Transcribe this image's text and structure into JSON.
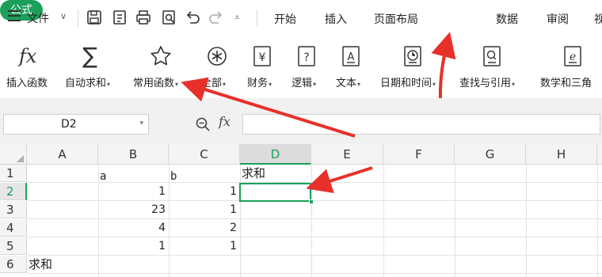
{
  "menubar": {
    "file_label": "文件",
    "tabs": [
      "开始",
      "插入",
      "页面布局",
      "公式",
      "数据",
      "审阅",
      "视"
    ],
    "active_tab": "公式",
    "accent_color": "#1aa05a"
  },
  "ribbon": {
    "buttons": [
      {
        "label": "插入函数",
        "icon": "fx-icon",
        "dropdown": false
      },
      {
        "label": "自动求和",
        "icon": "sum-icon",
        "dropdown": true
      },
      {
        "label": "常用函数",
        "icon": "star-icon",
        "dropdown": true
      },
      {
        "label": "全部",
        "icon": "asterisk-icon",
        "dropdown": true
      },
      {
        "label": "财务",
        "icon": "yen-icon",
        "dropdown": true
      },
      {
        "label": "逻辑",
        "icon": "question-icon",
        "dropdown": true
      },
      {
        "label": "文本",
        "icon": "text-a-icon",
        "dropdown": true
      },
      {
        "label": "日期和时间",
        "icon": "clock-icon",
        "dropdown": true
      },
      {
        "label": "查找与引用",
        "icon": "lookup-icon",
        "dropdown": true
      },
      {
        "label": "数学和三角",
        "icon": "math-e-icon",
        "dropdown": false
      }
    ]
  },
  "formula_bar": {
    "name_box": "D2",
    "fx_label": "fx",
    "formula": ""
  },
  "sheet": {
    "columns": [
      "A",
      "B",
      "C",
      "D",
      "E",
      "F",
      "G",
      "H"
    ],
    "active_column": "D",
    "rows": [
      "1",
      "2",
      "3",
      "4",
      "5",
      "6"
    ],
    "active_row": "2",
    "cells": {
      "B1": "a",
      "C1": "b",
      "D1": "求和",
      "B2": "1",
      "C2": "1",
      "B3": "23",
      "C3": "1",
      "B4": "4",
      "C4": "2",
      "B5": "1",
      "C5": "1",
      "A6": "求和"
    },
    "selected_cell": "D2"
  },
  "annotations": {
    "arrow_color": "#e8302a"
  }
}
